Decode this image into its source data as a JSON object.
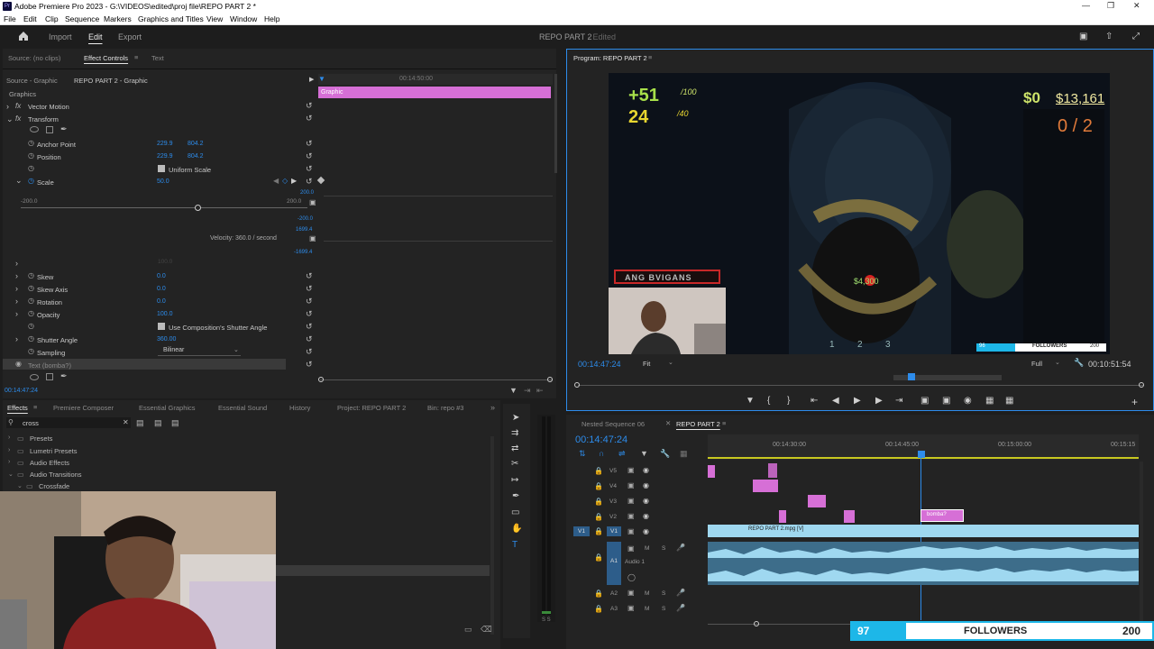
{
  "app": {
    "title": "Adobe Premiere Pro 2023 - G:\\VIDEOS\\edited\\proj file\\REPO PART 2 *",
    "icon": "Pr"
  },
  "menu": [
    "File",
    "Edit",
    "Clip",
    "Sequence",
    "Markers",
    "Graphics and Titles",
    "View",
    "Window",
    "Help"
  ],
  "workspace": {
    "tabs": [
      "Import",
      "Edit",
      "Export"
    ],
    "active": "Edit",
    "project_title": "REPO PART 2",
    "edited_label": "- Edited"
  },
  "effect_controls": {
    "tabs": [
      "Source: (no clips)",
      "Effect Controls",
      "Text"
    ],
    "source_label": "Source - Graphic",
    "clip_label": "REPO PART 2 - Graphic",
    "timecode_ruler": "00:14:50:00",
    "graphic_clip_label": "Graphic",
    "section": "Graphics",
    "props": [
      {
        "name": "Vector Motion"
      },
      {
        "name": "Transform"
      },
      {
        "name": "Anchor Point",
        "v1": "229.9",
        "v2": "804.2"
      },
      {
        "name": "Position",
        "v1": "229.9",
        "v2": "804.2"
      },
      {
        "name": "Uniform Scale"
      },
      {
        "name": "Scale",
        "v1": "50.0"
      },
      {
        "name": "Skew",
        "v1": "0.0"
      },
      {
        "name": "Skew Axis",
        "v1": "0.0"
      },
      {
        "name": "Rotation",
        "v1": "0.0"
      },
      {
        "name": "Opacity",
        "v1": "100.0"
      },
      {
        "name": "Use Composition's Shutter Angle"
      },
      {
        "name": "Shutter Angle",
        "v1": "360.00"
      },
      {
        "name": "Sampling",
        "v1": "Bilinear"
      },
      {
        "name": "Text (bomba?)"
      }
    ],
    "scale_min": "-200.0",
    "scale_max": "200.0",
    "graph_vals": [
      "200.0",
      "-200.0",
      "1699.4",
      "-1699.4"
    ],
    "velocity": "Velocity: 360.0 / second",
    "faded_val": "100.0",
    "timecode": "00:14:47:24"
  },
  "effects": {
    "tabs": [
      "Effects",
      "Premiere Composer",
      "Essential Graphics",
      "Essential Sound",
      "History",
      "Project: REPO PART 2",
      "Bin: repo #3"
    ],
    "search": "cross",
    "tree": [
      "Presets",
      "Lumetri Presets",
      "Audio Effects",
      "Audio Transitions",
      "Crossfade"
    ]
  },
  "program": {
    "title": "Program: REPO PART 2",
    "timecode": "00:14:47:24",
    "fit": "Fit",
    "quality": "Full",
    "duration": "00:10:51:54",
    "hud": {
      "health": "+51",
      "health_max": "/100",
      "stamina": "24",
      "stamina_max": "/40",
      "money_symbol": "$0",
      "money": "$13,161",
      "objective": "0 / 2",
      "price": "$4,300",
      "slots": [
        "1",
        "2",
        "3"
      ],
      "nametag": "ANG BVIGANS"
    },
    "mini_follow": {
      "count": "96",
      "label": "FOLLOWERS",
      "goal": "200"
    }
  },
  "timeline": {
    "tabs": [
      "Nested Sequence 06",
      "REPO PART 2"
    ],
    "active": "REPO PART 2",
    "timecode": "00:14:47:24",
    "ruler": [
      "00:14:30:00",
      "00:14:45:00",
      "00:15:00:00",
      "00:15:15"
    ],
    "video_tracks": [
      "V5",
      "V4",
      "V3",
      "V2",
      "V1"
    ],
    "audio_tracks": [
      "A1",
      "A2",
      "A3"
    ],
    "v1_clip": "REPO PART 2.mpg [V]",
    "v2_clip": "bomba?",
    "audio_name": "Audio 1"
  },
  "overlay": {
    "count": "97",
    "label": "FOLLOWERS",
    "goal": "200"
  },
  "colors": {
    "accent": "#2d8ceb",
    "clip_pink": "#d66fd6",
    "clip_blue": "#9fd8f0",
    "follower_bar": "#1db7e8"
  }
}
